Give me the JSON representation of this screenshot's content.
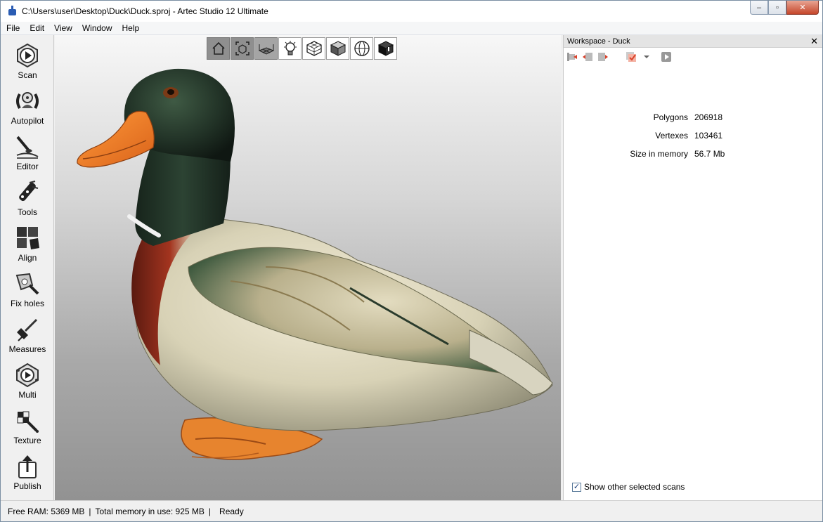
{
  "window": {
    "title": "C:\\Users\\user\\Desktop\\Duck\\Duck.sproj - Artec Studio 12 Ultimate",
    "controls": {
      "minimize": "–",
      "maximize": "▫",
      "close": "✕"
    }
  },
  "menu": [
    {
      "label": "File"
    },
    {
      "label": "Edit"
    },
    {
      "label": "View"
    },
    {
      "label": "Window"
    },
    {
      "label": "Help"
    }
  ],
  "left_tools": [
    {
      "label": "Scan",
      "icon": "scan-icon"
    },
    {
      "label": "Autopilot",
      "icon": "autopilot-icon"
    },
    {
      "label": "Editor",
      "icon": "editor-icon"
    },
    {
      "label": "Tools",
      "icon": "tools-icon"
    },
    {
      "label": "Align",
      "icon": "align-icon"
    },
    {
      "label": "Fix holes",
      "icon": "fix-holes-icon"
    },
    {
      "label": "Measures",
      "icon": "measures-icon"
    },
    {
      "label": "Multi",
      "icon": "multi-icon"
    },
    {
      "label": "Texture",
      "icon": "texture-icon"
    },
    {
      "label": "Publish",
      "icon": "publish-icon"
    }
  ],
  "viewport_toolbar": [
    {
      "icon": "home-view-icon"
    },
    {
      "icon": "fit-view-icon"
    },
    {
      "icon": "grid-floor-icon"
    },
    {
      "icon": "light-bulb-icon"
    },
    {
      "icon": "wireframe-icon"
    },
    {
      "icon": "shaded-cube-icon"
    },
    {
      "icon": "sphere-wire-icon"
    },
    {
      "icon": "dark-cube-icon"
    }
  ],
  "workspace": {
    "title": "Workspace - Duck",
    "close": "✕",
    "stats": [
      {
        "label": "Polygons",
        "value": "206918"
      },
      {
        "label": "Vertexes",
        "value": "103461"
      },
      {
        "label": "Size in memory",
        "value": "56.7 Mb"
      }
    ],
    "show_other_label": "Show other selected scans",
    "show_other_checked": true
  },
  "status": {
    "free_ram": "Free RAM: 5369 MB",
    "total_memory": "Total memory in use: 925 MB",
    "state": "Ready",
    "separator": "|"
  },
  "colors": {
    "accent": "#2a5cb3",
    "close_button": "#c5462a"
  }
}
